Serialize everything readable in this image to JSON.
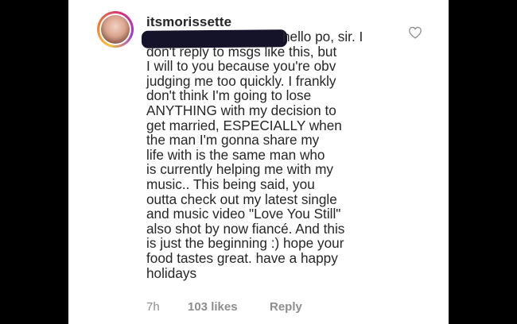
{
  "comment": {
    "username": "itsmorissette",
    "lines": [
      "hello po, sir. I",
      "don't reply to msgs like this, but",
      "I will to you because you're obv",
      "judging me too quickly. I frankly",
      "don't think I'm going to lose",
      "ANYTHING with my decision to",
      "get married, ESPECIALLY when",
      "the man I'm gonna share my",
      "life with is the same man who",
      "is currently helping me with my",
      "music.. This being said, you",
      "outta check out my latest single",
      "and music video \"Love You Still\"",
      "also shot by now fiancé. And this",
      "is just the beginning :) hope your",
      "food tastes great. have a happy",
      "holidays"
    ],
    "timestamp": "7h",
    "likes": "103 likes",
    "reply_label": "Reply"
  },
  "icons": {
    "like": "heart-outline-icon",
    "avatar": "profile-picture"
  },
  "colors": {
    "background": "#000000",
    "card": "#ffffff",
    "text": "#262626",
    "meta_text": "#8e8e8e",
    "redaction": "#15132a"
  }
}
